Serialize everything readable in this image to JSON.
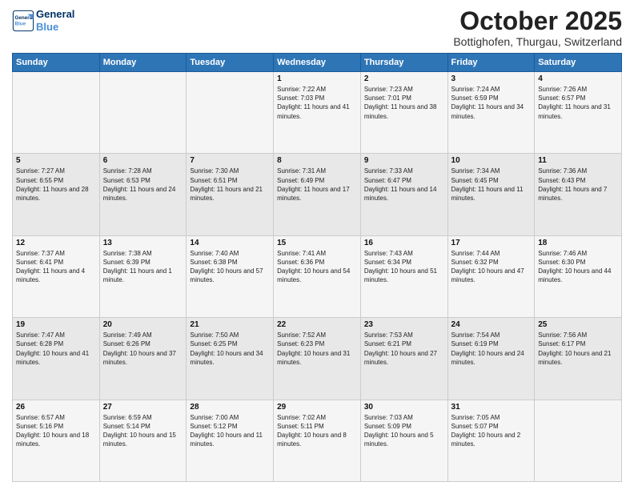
{
  "header": {
    "logo_line1": "General",
    "logo_line2": "Blue",
    "month": "October 2025",
    "location": "Bottighofen, Thurgau, Switzerland"
  },
  "days_of_week": [
    "Sunday",
    "Monday",
    "Tuesday",
    "Wednesday",
    "Thursday",
    "Friday",
    "Saturday"
  ],
  "weeks": [
    [
      {
        "day": "",
        "info": ""
      },
      {
        "day": "",
        "info": ""
      },
      {
        "day": "",
        "info": ""
      },
      {
        "day": "1",
        "info": "Sunrise: 7:22 AM\nSunset: 7:03 PM\nDaylight: 11 hours and 41 minutes."
      },
      {
        "day": "2",
        "info": "Sunrise: 7:23 AM\nSunset: 7:01 PM\nDaylight: 11 hours and 38 minutes."
      },
      {
        "day": "3",
        "info": "Sunrise: 7:24 AM\nSunset: 6:59 PM\nDaylight: 11 hours and 34 minutes."
      },
      {
        "day": "4",
        "info": "Sunrise: 7:26 AM\nSunset: 6:57 PM\nDaylight: 11 hours and 31 minutes."
      }
    ],
    [
      {
        "day": "5",
        "info": "Sunrise: 7:27 AM\nSunset: 6:55 PM\nDaylight: 11 hours and 28 minutes."
      },
      {
        "day": "6",
        "info": "Sunrise: 7:28 AM\nSunset: 6:53 PM\nDaylight: 11 hours and 24 minutes."
      },
      {
        "day": "7",
        "info": "Sunrise: 7:30 AM\nSunset: 6:51 PM\nDaylight: 11 hours and 21 minutes."
      },
      {
        "day": "8",
        "info": "Sunrise: 7:31 AM\nSunset: 6:49 PM\nDaylight: 11 hours and 17 minutes."
      },
      {
        "day": "9",
        "info": "Sunrise: 7:33 AM\nSunset: 6:47 PM\nDaylight: 11 hours and 14 minutes."
      },
      {
        "day": "10",
        "info": "Sunrise: 7:34 AM\nSunset: 6:45 PM\nDaylight: 11 hours and 11 minutes."
      },
      {
        "day": "11",
        "info": "Sunrise: 7:36 AM\nSunset: 6:43 PM\nDaylight: 11 hours and 7 minutes."
      }
    ],
    [
      {
        "day": "12",
        "info": "Sunrise: 7:37 AM\nSunset: 6:41 PM\nDaylight: 11 hours and 4 minutes."
      },
      {
        "day": "13",
        "info": "Sunrise: 7:38 AM\nSunset: 6:39 PM\nDaylight: 11 hours and 1 minute."
      },
      {
        "day": "14",
        "info": "Sunrise: 7:40 AM\nSunset: 6:38 PM\nDaylight: 10 hours and 57 minutes."
      },
      {
        "day": "15",
        "info": "Sunrise: 7:41 AM\nSunset: 6:36 PM\nDaylight: 10 hours and 54 minutes."
      },
      {
        "day": "16",
        "info": "Sunrise: 7:43 AM\nSunset: 6:34 PM\nDaylight: 10 hours and 51 minutes."
      },
      {
        "day": "17",
        "info": "Sunrise: 7:44 AM\nSunset: 6:32 PM\nDaylight: 10 hours and 47 minutes."
      },
      {
        "day": "18",
        "info": "Sunrise: 7:46 AM\nSunset: 6:30 PM\nDaylight: 10 hours and 44 minutes."
      }
    ],
    [
      {
        "day": "19",
        "info": "Sunrise: 7:47 AM\nSunset: 6:28 PM\nDaylight: 10 hours and 41 minutes."
      },
      {
        "day": "20",
        "info": "Sunrise: 7:49 AM\nSunset: 6:26 PM\nDaylight: 10 hours and 37 minutes."
      },
      {
        "day": "21",
        "info": "Sunrise: 7:50 AM\nSunset: 6:25 PM\nDaylight: 10 hours and 34 minutes."
      },
      {
        "day": "22",
        "info": "Sunrise: 7:52 AM\nSunset: 6:23 PM\nDaylight: 10 hours and 31 minutes."
      },
      {
        "day": "23",
        "info": "Sunrise: 7:53 AM\nSunset: 6:21 PM\nDaylight: 10 hours and 27 minutes."
      },
      {
        "day": "24",
        "info": "Sunrise: 7:54 AM\nSunset: 6:19 PM\nDaylight: 10 hours and 24 minutes."
      },
      {
        "day": "25",
        "info": "Sunrise: 7:56 AM\nSunset: 6:17 PM\nDaylight: 10 hours and 21 minutes."
      }
    ],
    [
      {
        "day": "26",
        "info": "Sunrise: 6:57 AM\nSunset: 5:16 PM\nDaylight: 10 hours and 18 minutes."
      },
      {
        "day": "27",
        "info": "Sunrise: 6:59 AM\nSunset: 5:14 PM\nDaylight: 10 hours and 15 minutes."
      },
      {
        "day": "28",
        "info": "Sunrise: 7:00 AM\nSunset: 5:12 PM\nDaylight: 10 hours and 11 minutes."
      },
      {
        "day": "29",
        "info": "Sunrise: 7:02 AM\nSunset: 5:11 PM\nDaylight: 10 hours and 8 minutes."
      },
      {
        "day": "30",
        "info": "Sunrise: 7:03 AM\nSunset: 5:09 PM\nDaylight: 10 hours and 5 minutes."
      },
      {
        "day": "31",
        "info": "Sunrise: 7:05 AM\nSunset: 5:07 PM\nDaylight: 10 hours and 2 minutes."
      },
      {
        "day": "",
        "info": ""
      }
    ]
  ]
}
